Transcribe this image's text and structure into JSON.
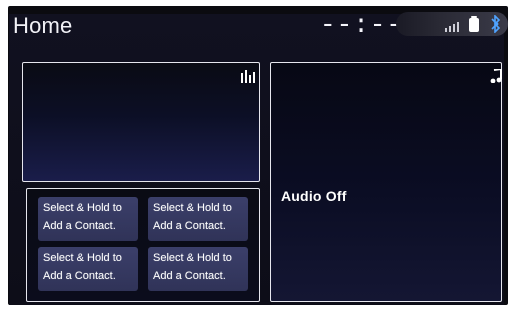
{
  "header": {
    "title": "Home",
    "clock": "--:--"
  },
  "status": {
    "signal_icon": "signal-icon",
    "battery_icon": "phone-battery-icon",
    "bluetooth_icon": "bluetooth-icon"
  },
  "widgets": {
    "top_left_icon": "equalizer-icon",
    "audio_icon": "music-note-icon",
    "audio_label": "Audio Off"
  },
  "contacts": {
    "tiles": [
      {
        "label": "Select & Hold to\nAdd a Contact."
      },
      {
        "label": "Select & Hold to\nAdd a Contact."
      },
      {
        "label": "Select & Hold to\nAdd a Contact."
      },
      {
        "label": "Select & Hold to\nAdd a Contact."
      }
    ]
  }
}
